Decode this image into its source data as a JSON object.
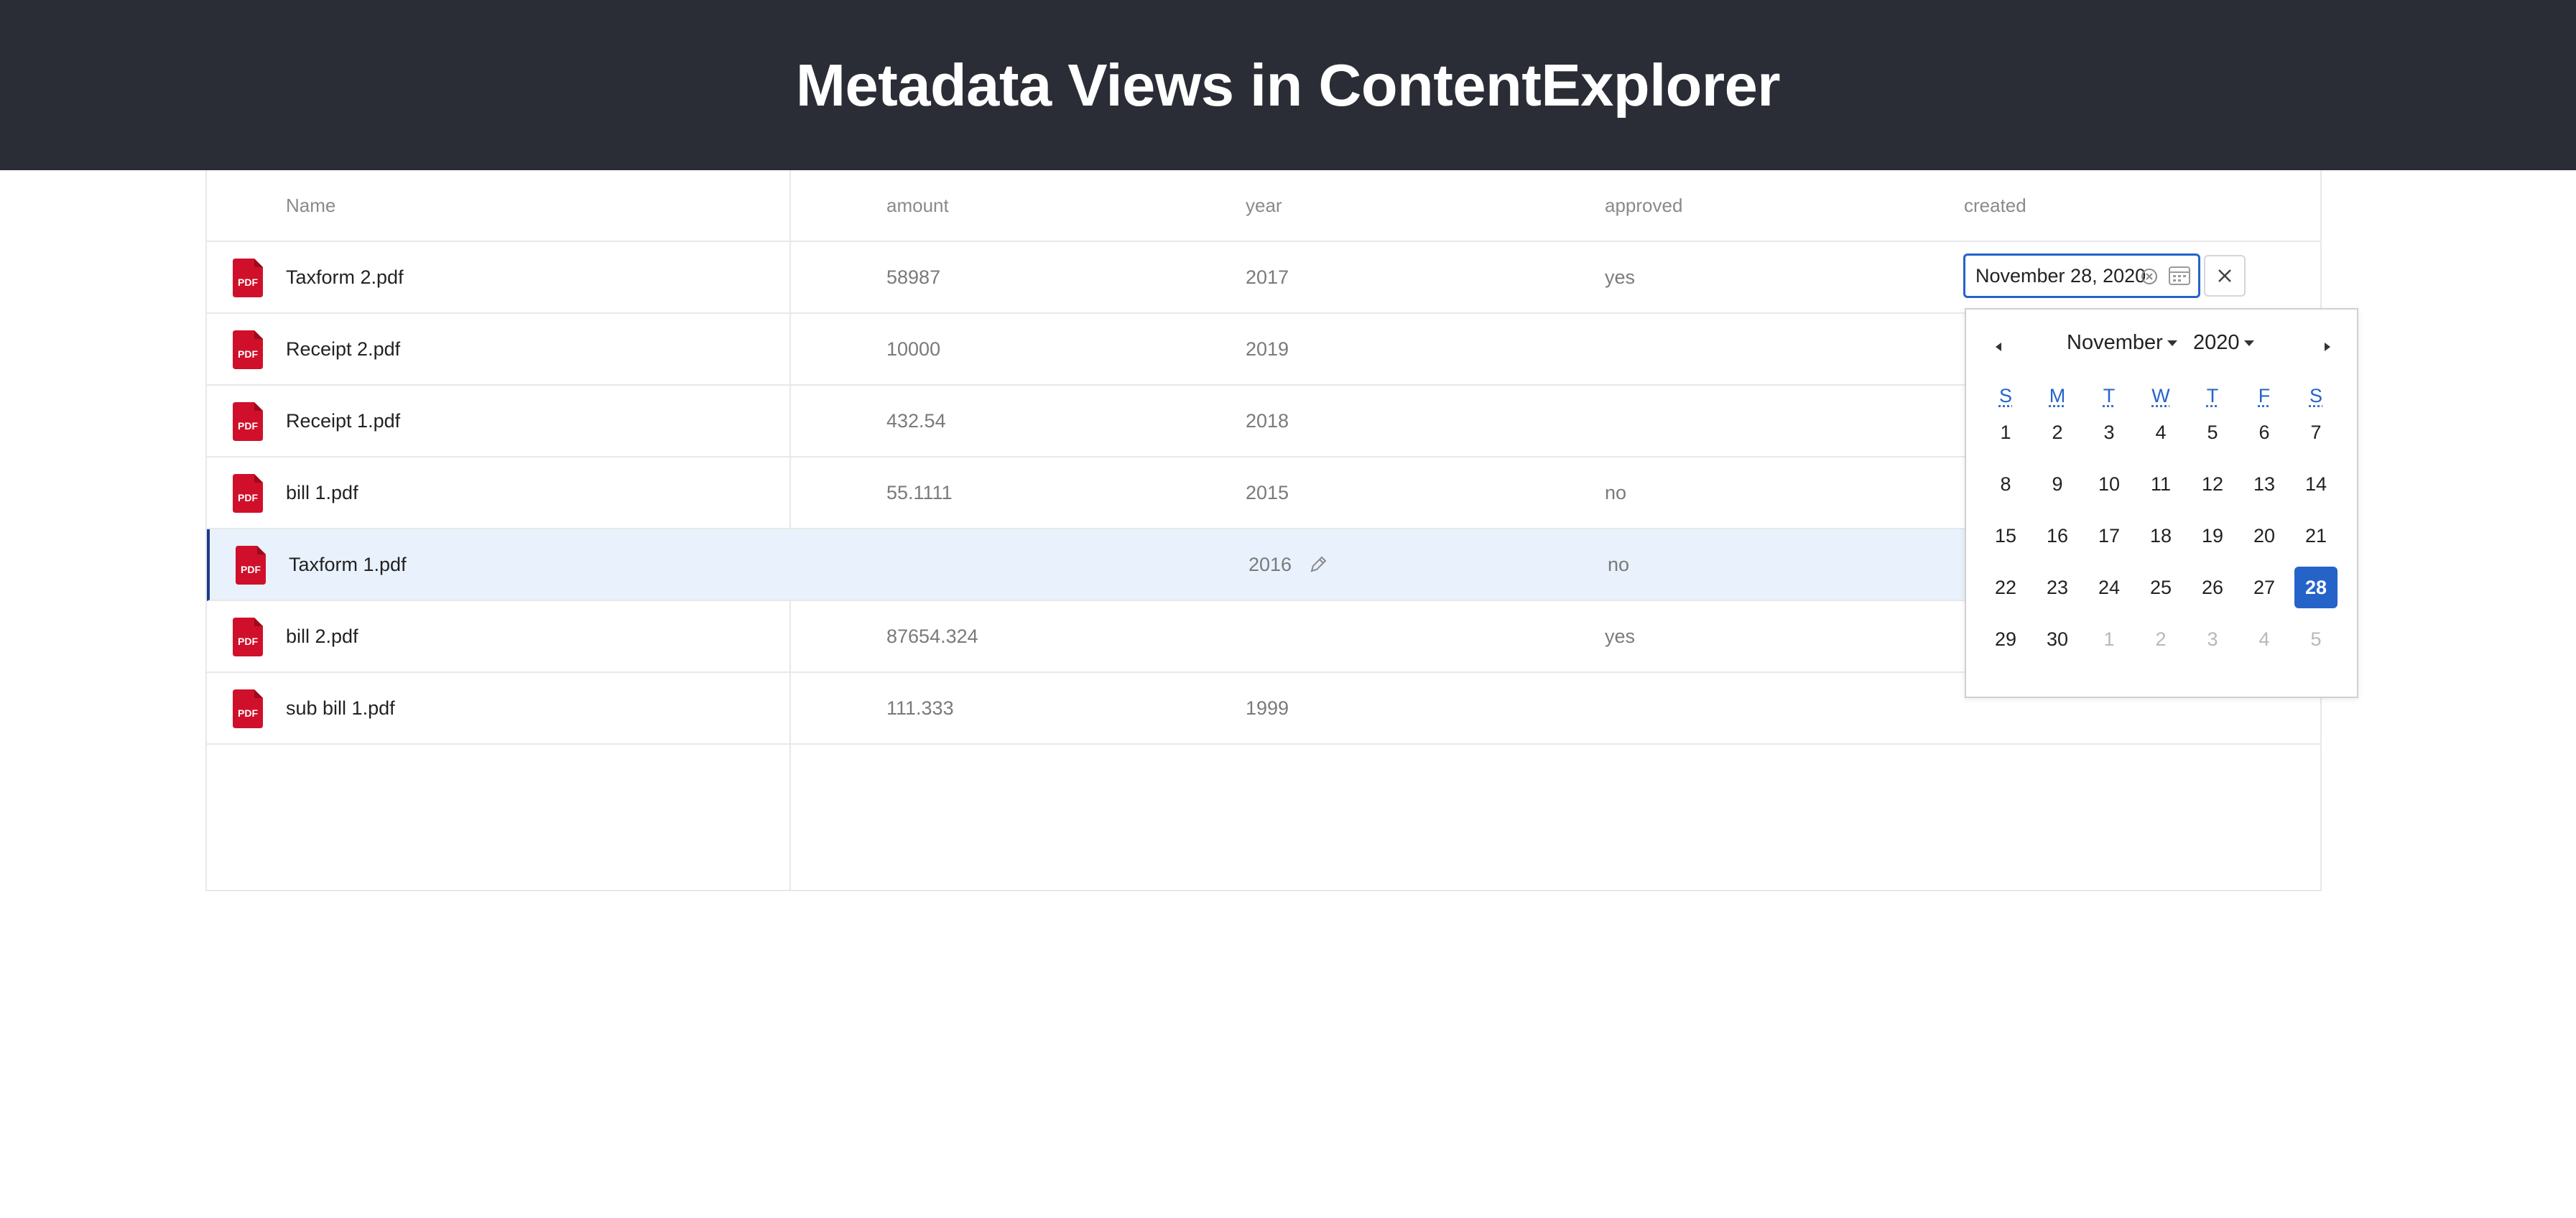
{
  "header": {
    "title": "Metadata Views in ContentExplorer"
  },
  "table": {
    "columns": [
      "Name",
      "amount",
      "year",
      "approved",
      "created"
    ],
    "rows": [
      {
        "name": "Taxform 2.pdf",
        "amount": "58987",
        "year": "2017",
        "approved": "yes"
      },
      {
        "name": "Receipt 2.pdf",
        "amount": "10000",
        "year": "2019",
        "approved": ""
      },
      {
        "name": "Receipt 1.pdf",
        "amount": "432.54",
        "year": "2018",
        "approved": ""
      },
      {
        "name": "bill 1.pdf",
        "amount": "55.1111",
        "year": "2015",
        "approved": "no"
      },
      {
        "name": "Taxform 1.pdf",
        "amount": "",
        "year": "2016",
        "approved": "no"
      },
      {
        "name": "bill 2.pdf",
        "amount": "87654.324",
        "year": "",
        "approved": "yes"
      },
      {
        "name": "sub bill 1.pdf",
        "amount": "111.333",
        "year": "1999",
        "approved": ""
      }
    ],
    "file_icon": "pdf-icon",
    "file_icon_label": "PDF",
    "file_icon_color": "#d0102a",
    "selected_row_index": 4
  },
  "date_editor": {
    "value": "November 28, 2020",
    "accent_color": "#2563c9"
  },
  "calendar": {
    "month": "November",
    "year": "2020",
    "weekdays": [
      "S",
      "M",
      "T",
      "W",
      "T",
      "F",
      "S"
    ],
    "weeks": [
      [
        "1",
        "2",
        "3",
        "4",
        "5",
        "6",
        "7"
      ],
      [
        "8",
        "9",
        "10",
        "11",
        "12",
        "13",
        "14"
      ],
      [
        "15",
        "16",
        "17",
        "18",
        "19",
        "20",
        "21"
      ],
      [
        "22",
        "23",
        "24",
        "25",
        "26",
        "27",
        "28"
      ],
      [
        "29",
        "30",
        "1",
        "2",
        "3",
        "4",
        "5"
      ]
    ],
    "selected_day": "28"
  }
}
